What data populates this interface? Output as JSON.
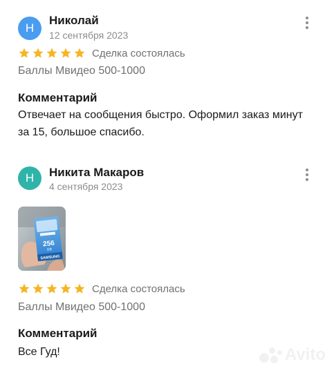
{
  "colors": {
    "star": "#f5b524",
    "avatar_1": "#4a9cf0",
    "avatar_2": "#2fb4a9",
    "muted_text": "#8c8c8c"
  },
  "reviews": [
    {
      "avatar_letter": "Н",
      "author": "Николай",
      "date": "12 сентября 2023",
      "rating": 5,
      "deal_status": "Сделка состоялась",
      "deal_item": "Баллы Мвидео 500-1000",
      "comment_heading": "Комментарий",
      "comment_text": "Отвечает на сообщения быстро. Оформил заказ минут за 15, большое спасибо."
    },
    {
      "avatar_letter": "Н",
      "author": "Никита Макаров",
      "date": "4 сентября 2023",
      "photo": {
        "card_brand": "SAMSUNG",
        "card_capacity": "256",
        "card_capacity_unit": "GB"
      },
      "rating": 5,
      "deal_status": "Сделка состоялась",
      "deal_item": "Баллы Мвидео 500-1000",
      "comment_heading": "Комментарий",
      "comment_text": "Все Гуд!"
    }
  ],
  "watermark": {
    "text": "Avito"
  }
}
